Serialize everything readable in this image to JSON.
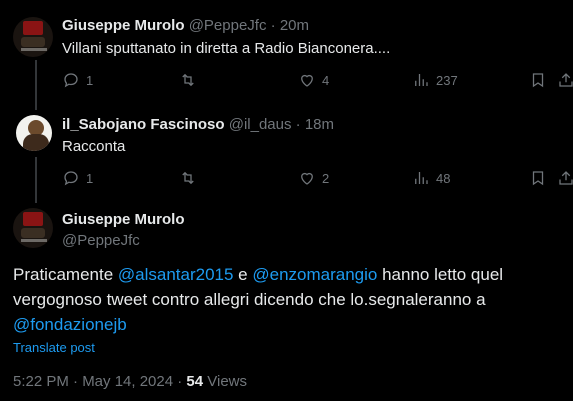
{
  "tweets": [
    {
      "name": "Giuseppe Murolo",
      "handle": "@PeppeJfc",
      "sep": "·",
      "time": "20m",
      "text": "Villani sputtanato in diretta a Radio Bianconera....",
      "replies": "1",
      "retweets": "",
      "likes": "4",
      "views": "237"
    },
    {
      "name": "il_Sabojano Fascinoso",
      "handle": "@il_daus",
      "sep": "·",
      "time": "18m",
      "text": "Racconta",
      "replies": "1",
      "retweets": "",
      "likes": "2",
      "views": "48"
    }
  ],
  "main": {
    "name": "Giuseppe Murolo",
    "handle": "@PeppeJfc",
    "text_part1": "Praticamente ",
    "mention1": "@alsantar2015",
    "text_part2": " e ",
    "mention2": "@enzomarangio",
    "text_part3": " hanno letto quel vergognoso tweet contro allegri dicendo che lo.segnaleranno a ",
    "mention3": "@fondazionejb",
    "translate": "Translate post",
    "timestamp": "5:22 PM · May 14, 2024 · ",
    "views_count": "54",
    "views_label": " Views"
  },
  "icons": [
    "reply-icon",
    "retweet-icon",
    "like-icon",
    "views-icon",
    "bookmark-icon",
    "share-icon"
  ]
}
